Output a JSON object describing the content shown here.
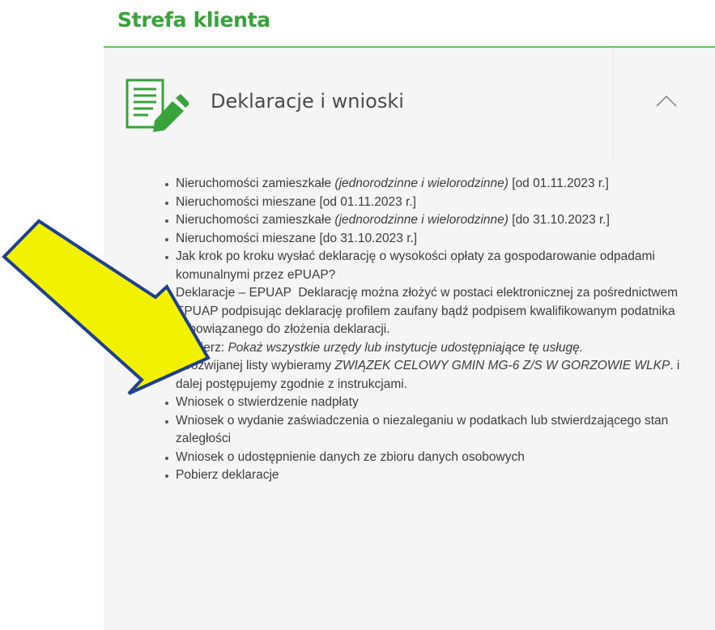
{
  "section": {
    "title": "Strefa klienta"
  },
  "panel": {
    "title": "Deklaracje i wnioski",
    "icon": "document-edit-icon",
    "toggle_icon": "chevron-up-icon",
    "colors": {
      "accent": "#37a33a",
      "panel_bg": "#f5f5f5",
      "arrow_fill": "#f2f200",
      "arrow_stroke": "#1f3f8f"
    }
  },
  "items": [
    {
      "text": "Nieruchomości zamieszkałe ",
      "em": "(jednorodzinne i wielorodzinne)",
      "suffix": " [od 01.11.2023 r.]"
    },
    {
      "text": "Nieruchomości mieszane [od 01.11.2023 r.]"
    },
    {
      "text": "Nieruchomości zamieszkałe ",
      "em": "(jednorodzinne i wielorodzinne)",
      "suffix": " [do 31.10.2023 r.]"
    },
    {
      "text": "Nieruchomości mieszane [do 31.10.2023 r.]"
    },
    {
      "text": "Jak krok po kroku wysłać deklarację o wysokości opłaty za gospodarowanie odpadami komunalnymi przez ePUAP?"
    },
    {
      "link": "Deklaracje – EPUAP",
      "desc": "  Deklarację można złożyć w postaci elektronicznej za pośrednictwem EPUAP podpisując deklarację profilem zaufany bądź podpisem kwalifikowanym podatnika zobowiązanego do złożenia deklaracji.",
      "choose_label": "Wybierz: ",
      "choose_em": "Pokaż wszystkie urzędy lub instytucje udostępniające tę usługę.",
      "list_label": "Z rozwijanej listy wybieramy ",
      "list_em": "ZWIĄZEK CELOWY GMIN MG-6 Z/S W GORZOWIE WLKP",
      "list_suffix": ". i dalej postępujemy zgodnie z instrukcjami."
    },
    {
      "text": "Wniosek o stwierdzenie nadpłaty"
    },
    {
      "text": "Wniosek o wydanie zaświadczenia o niezaleganiu w podatkach lub stwierdzającego stan zaległości"
    },
    {
      "text": "Wniosek o udostępnienie danych ze zbioru danych osobowych"
    },
    {
      "text": "Pobierz deklaracje"
    }
  ]
}
